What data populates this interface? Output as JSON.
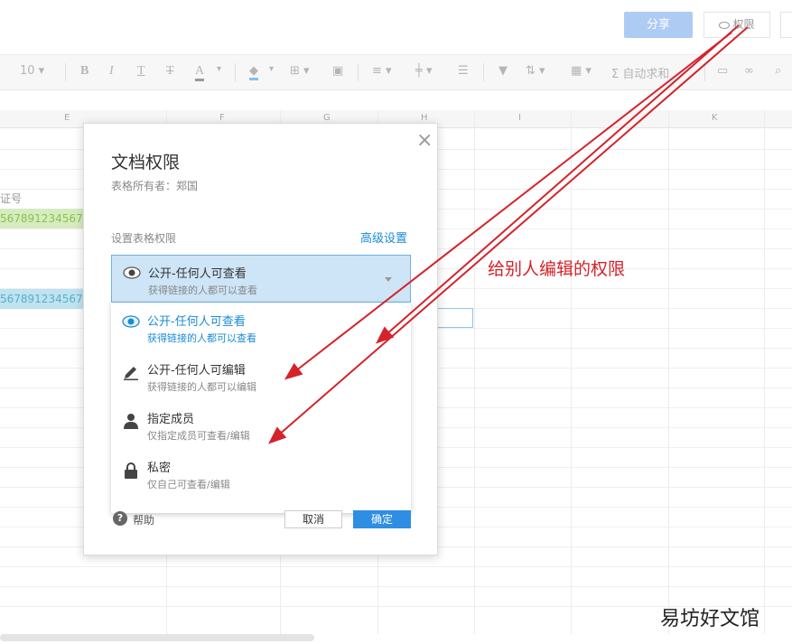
{
  "topbar": {
    "share_label": "分享",
    "permission_label": "权限"
  },
  "toolbar": {
    "font_size": "10",
    "bold": "B",
    "italic": "I",
    "underline": "T",
    "strike": "T",
    "font_color": "A",
    "autosum_label": "自动求和"
  },
  "grid": {
    "columns": [
      "E",
      "F",
      "G",
      "H",
      "I",
      "K"
    ],
    "cell_label": "证号",
    "cell_green_value": "567891234567",
    "cell_blue_value": "567891234567"
  },
  "dialog": {
    "title": "文档权限",
    "owner": "表格所有者：郑国",
    "setting_label": "设置表格权限",
    "advanced_link": "高级设置",
    "selected": {
      "title": "公开-任何人可查看",
      "subtitle": "获得链接的人都可以查看",
      "icon": "eye-icon"
    },
    "options": [
      {
        "title": "公开-任何人可查看",
        "subtitle": "获得链接的人都可以查看",
        "icon": "eye-icon",
        "active": true
      },
      {
        "title": "公开-任何人可编辑",
        "subtitle": "获得链接的人都可以编辑",
        "icon": "pencil-icon",
        "active": false
      },
      {
        "title": "指定成员",
        "subtitle": "仅指定成员可查看/编辑",
        "icon": "person-icon",
        "active": false
      },
      {
        "title": "私密",
        "subtitle": "仅自己可查看/编辑",
        "icon": "lock-icon",
        "active": false
      }
    ],
    "help_label": "帮助",
    "cancel_label": "取消",
    "ok_label": "确定"
  },
  "annotation": {
    "text": "给别人编辑的权限",
    "color": "#d4232a"
  },
  "watermark": "易坊好文馆",
  "colors": {
    "accent": "#1a8bd6",
    "primary_button": "#2f8de4",
    "share_button": "#aecbf3"
  }
}
